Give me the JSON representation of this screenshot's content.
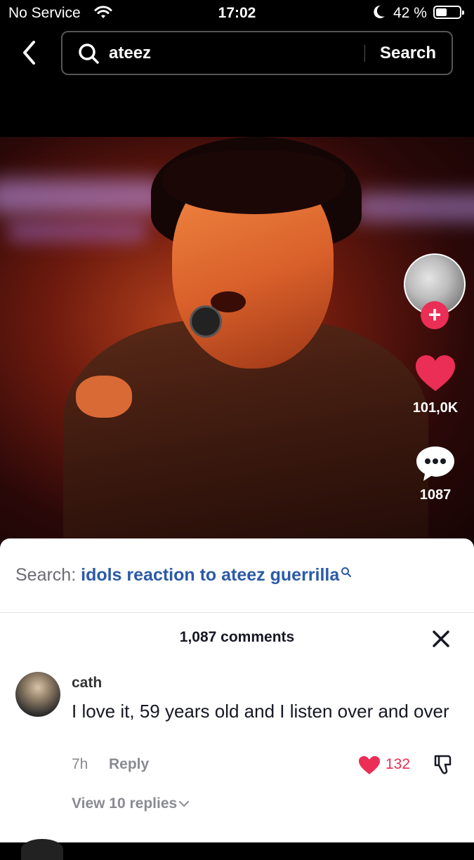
{
  "status_bar": {
    "carrier": "No Service",
    "time": "17:02",
    "battery": "42 %"
  },
  "search": {
    "query": "ateez",
    "button_label": "Search"
  },
  "video": {
    "likes": "101,0K",
    "comments": "1087"
  },
  "sheet": {
    "related_label": "Search:",
    "related_term": "idols reaction to ateez guerrilla",
    "comment_count": "1,087 comments"
  },
  "comments": [
    {
      "user": "cath",
      "text": "I love it, 59 years old and I listen over and over",
      "time": "7h",
      "reply_label": "Reply",
      "likes": "132",
      "view_replies": "View 10 replies"
    }
  ],
  "colors": {
    "accent": "#ea2e55",
    "link": "#2b5aa8"
  }
}
